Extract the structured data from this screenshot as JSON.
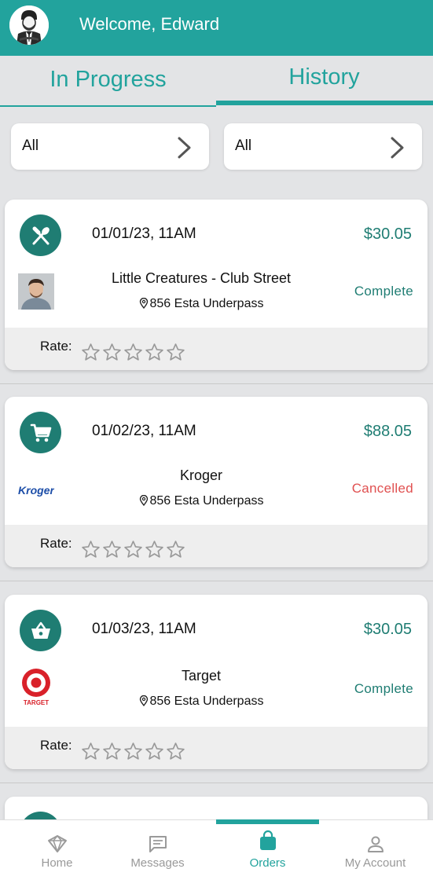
{
  "header": {
    "welcome_text": "Welcome, Edward",
    "avatar_icon": "user-avatar"
  },
  "tabs": [
    {
      "label": "In Progress",
      "active": false
    },
    {
      "label": "History",
      "active": true
    }
  ],
  "filters": [
    {
      "label": "All",
      "icon": "chevron-right-icon"
    },
    {
      "label": "All",
      "icon": "chevron-right-icon"
    }
  ],
  "orders": [
    {
      "category_icon": "utensils-icon",
      "date": "01/01/23, 11AM",
      "price": "$30.05",
      "store": "Little Creatures - Club Street",
      "address": "856 Esta Underpass",
      "status": "Complete",
      "logo": "person-photo",
      "rate_label": "Rate:",
      "rating": 0
    },
    {
      "category_icon": "cart-icon",
      "date": "01/02/23, 11AM",
      "price": "$88.05",
      "store": "Kroger",
      "address": "856 Esta Underpass",
      "status": "Cancelled",
      "logo": "kroger-logo",
      "logo_text": "Kroger",
      "rate_label": "Rate:",
      "rating": 0
    },
    {
      "category_icon": "basket-icon",
      "date": "01/03/23, 11AM",
      "price": "$30.05",
      "store": "Target",
      "address": "856 Esta Underpass",
      "status": "Complete",
      "logo": "target-logo",
      "logo_text": "TARGET",
      "rate_label": "Rate:",
      "rating": 0
    }
  ],
  "bottom_nav": [
    {
      "label": "Home",
      "icon": "home-icon",
      "active": false
    },
    {
      "label": "Messages",
      "icon": "messages-icon",
      "active": false
    },
    {
      "label": "Orders",
      "icon": "shopping-bag-icon",
      "active": true
    },
    {
      "label": "My Account",
      "icon": "account-icon",
      "active": false
    }
  ],
  "colors": {
    "brand": "#22a39d",
    "brand_dark": "#1f7d73",
    "cancelled": "#e05050",
    "background": "#e3e4e6"
  }
}
